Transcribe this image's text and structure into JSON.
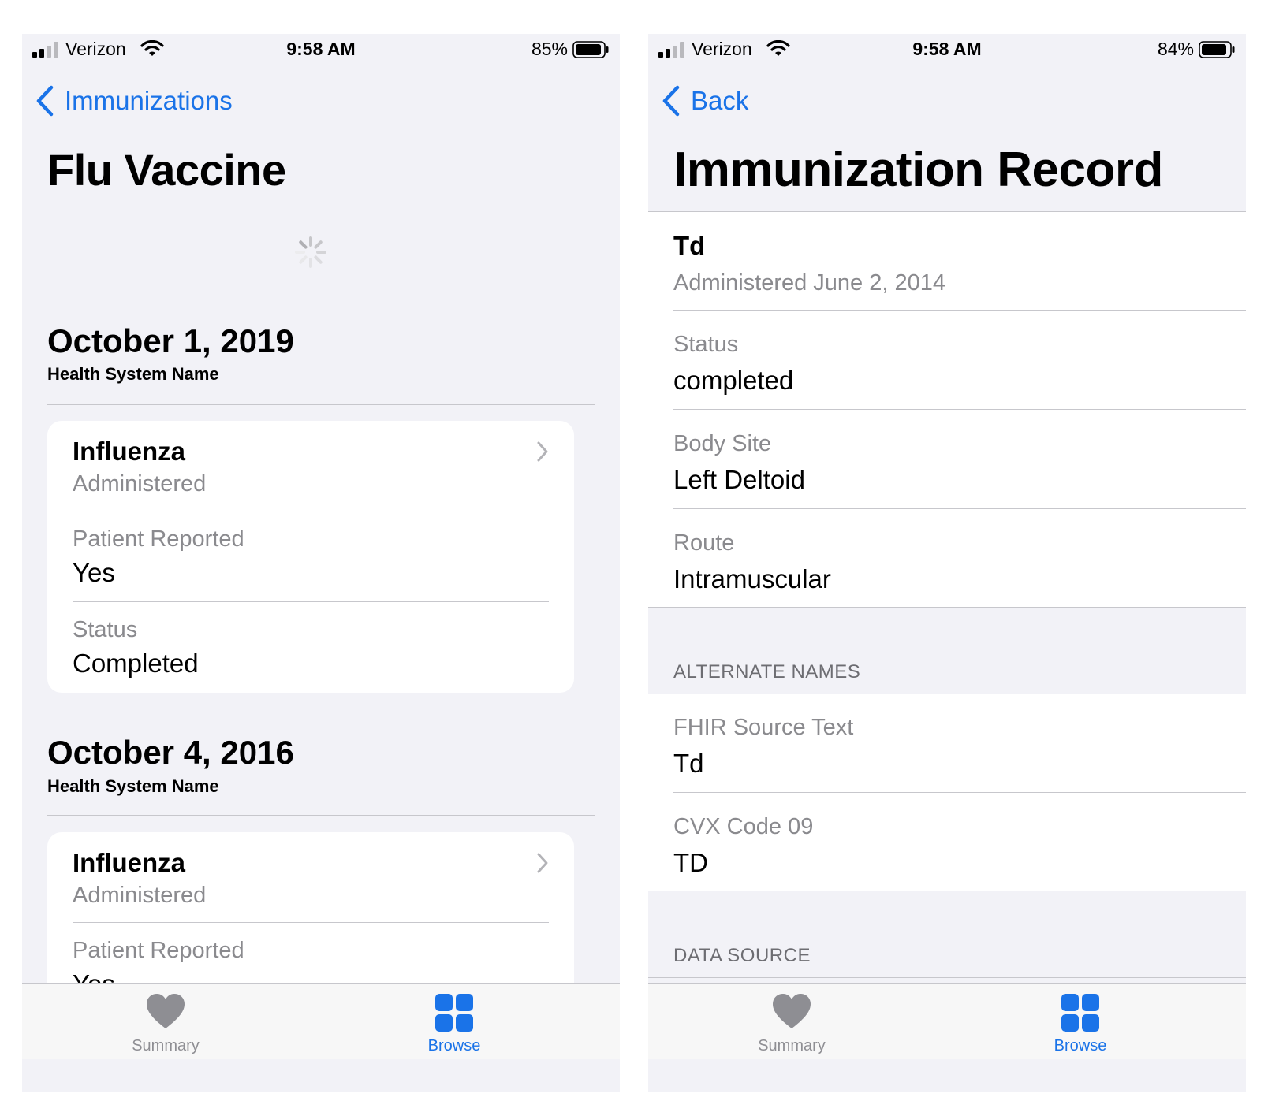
{
  "colors": {
    "accent": "#1a73e8",
    "secondary_text": "#8a8a8e",
    "background": "#f2f2f7"
  },
  "left": {
    "status": {
      "carrier": "Verizon",
      "time": "9:58 AM",
      "battery": "85%"
    },
    "back_label": "Immunizations",
    "title": "Flu Vaccine",
    "groups": [
      {
        "date": "October 1, 2019",
        "health_system": "Health System Name",
        "record": {
          "title": "Influenza",
          "subtitle": "Administered",
          "fields": [
            {
              "label": "Patient Reported",
              "value": "Yes"
            },
            {
              "label": "Status",
              "value": "Completed"
            }
          ]
        }
      },
      {
        "date": "October 4, 2016",
        "health_system": "Health System Name",
        "record": {
          "title": "Influenza",
          "subtitle": "Administered",
          "fields": [
            {
              "label": "Patient Reported",
              "value": "Yes"
            }
          ]
        }
      }
    ],
    "tabs": {
      "summary": "Summary",
      "browse": "Browse"
    }
  },
  "right": {
    "status": {
      "carrier": "Verizon",
      "time": "9:58 AM",
      "battery": "84%"
    },
    "back_label": "Back",
    "title": "Immunization Record",
    "record": {
      "name": "Td",
      "administered": "Administered June 2, 2014"
    },
    "fields": [
      {
        "label": "Status",
        "value": "completed"
      },
      {
        "label": "Body Site",
        "value": "Left Deltoid"
      },
      {
        "label": "Route",
        "value": "Intramuscular"
      }
    ],
    "alternate_names_header": "ALTERNATE NAMES",
    "alternate_names": [
      {
        "label": "FHIR Source Text",
        "value": "Td"
      },
      {
        "label": "CVX Code 09",
        "value": "TD"
      }
    ],
    "data_source_header": "DATA SOURCE",
    "tabs": {
      "summary": "Summary",
      "browse": "Browse"
    }
  }
}
